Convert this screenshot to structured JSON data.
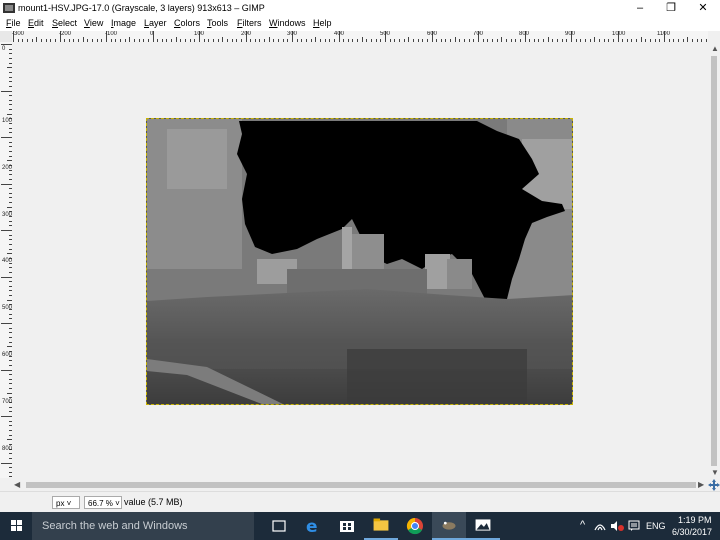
{
  "window": {
    "title": "mount1-HSV.JPG-17.0 (Grayscale, 3 layers) 913x613 – GIMP",
    "controls": {
      "minimize": "–",
      "restore": "❐",
      "close": "✕"
    }
  },
  "menu": [
    "File",
    "Edit",
    "Select",
    "View",
    "Image",
    "Layer",
    "Colors",
    "Tools",
    "Filters",
    "Windows",
    "Help"
  ],
  "ruler": {
    "top_labels": [
      "-300",
      "-200",
      "-100",
      "0",
      "100",
      "200",
      "300",
      "400",
      "500",
      "600",
      "700",
      "800",
      "900",
      "1000",
      "1100"
    ],
    "left_labels": [
      "0",
      "100",
      "200",
      "300",
      "400",
      "500",
      "600",
      "700",
      "800"
    ]
  },
  "statusbar": {
    "unit": "px",
    "zoom": "66.7 %",
    "info": "value (5.7 MB)"
  },
  "taskbar": {
    "search_placeholder": "Search the web and Windows",
    "time": "1:19 PM",
    "date": "6/30/2017",
    "language": "ENG",
    "apps": [
      "task-view",
      "edge",
      "store",
      "file-explorer",
      "chrome",
      "gimp",
      "photos"
    ]
  },
  "colors": {
    "taskbar_bg": "#1c2b3a",
    "selection_border": "#c8b400",
    "accent": "#6fa8dc"
  }
}
